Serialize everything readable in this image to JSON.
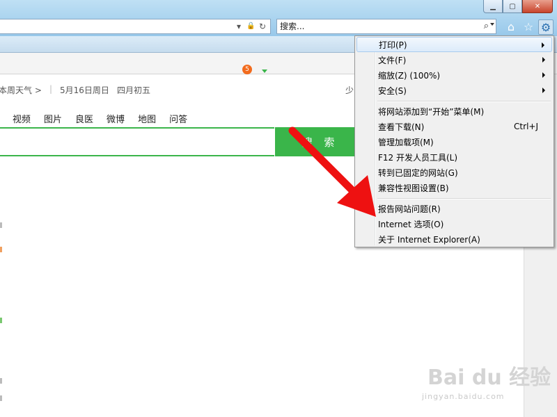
{
  "window": {
    "min": "▁",
    "max": "▢",
    "close": "✕"
  },
  "address": {
    "lock": "🔒",
    "refresh": "↻",
    "dropdown": "▾"
  },
  "search": {
    "placeholder": "搜索...",
    "icon": "⌕"
  },
  "toolbar": {
    "home": "⌂",
    "favorites": "☆",
    "tools": "⚙"
  },
  "page": {
    "weather": "本周天气 >",
    "divider": "|",
    "date": "5月16日周日",
    "lunar": "四月初五",
    "right_text": "少",
    "nav": [
      "视频",
      "图片",
      "良医",
      "微博",
      "地图",
      "问答"
    ],
    "badge": "5",
    "search_button": "搜 索"
  },
  "menu": {
    "items": [
      {
        "label": "打印(P)",
        "submenu": true,
        "highlighted": true
      },
      {
        "label": "文件(F)",
        "submenu": true
      },
      {
        "label": "缩放(Z) (100%)",
        "submenu": true
      },
      {
        "label": "安全(S)",
        "submenu": true
      },
      {
        "label": "将网站添加到“开始”菜单(M)"
      },
      {
        "label": "查看下载(N)",
        "shortcut": "Ctrl+J"
      },
      {
        "label": "管理加载项(M)"
      },
      {
        "label": "F12 开发人员工具(L)"
      },
      {
        "label": "转到已固定的网站(G)"
      },
      {
        "label": "兼容性视图设置(B)"
      },
      {
        "label": "报告网站问题(R)"
      },
      {
        "label": "Internet 选项(O)"
      },
      {
        "label": "关于 Internet Explorer(A)"
      }
    ]
  },
  "colors": {
    "accent_green": "#3ab54a",
    "arrow_red": "#ee1111",
    "badge_orange": "#f26b1d"
  },
  "watermark": {
    "logo": "Bai du 经验",
    "url": "jingyan.baidu.com"
  }
}
